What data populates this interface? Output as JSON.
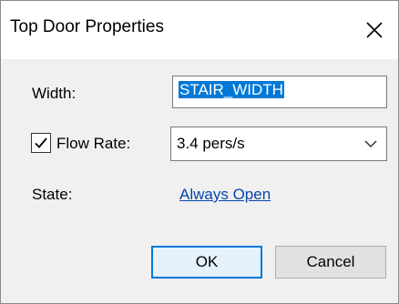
{
  "window": {
    "title": "Top Door Properties",
    "close_label": "close"
  },
  "form": {
    "width_label": "Width:",
    "width_value": "STAIR_WIDTH",
    "flow_rate_label": "Flow Rate:",
    "flow_rate_checked": true,
    "flow_rate_value": "3.4 pers/s",
    "state_label": "State:",
    "state_value": "Always Open"
  },
  "buttons": {
    "ok": "OK",
    "cancel": "Cancel"
  },
  "icons": {
    "close": "close-icon",
    "check": "check-icon",
    "dropdown": "chevron-down-icon"
  },
  "colors": {
    "selection": "#0078d7",
    "link": "#0645ad",
    "default_button_border": "#0078d7"
  }
}
